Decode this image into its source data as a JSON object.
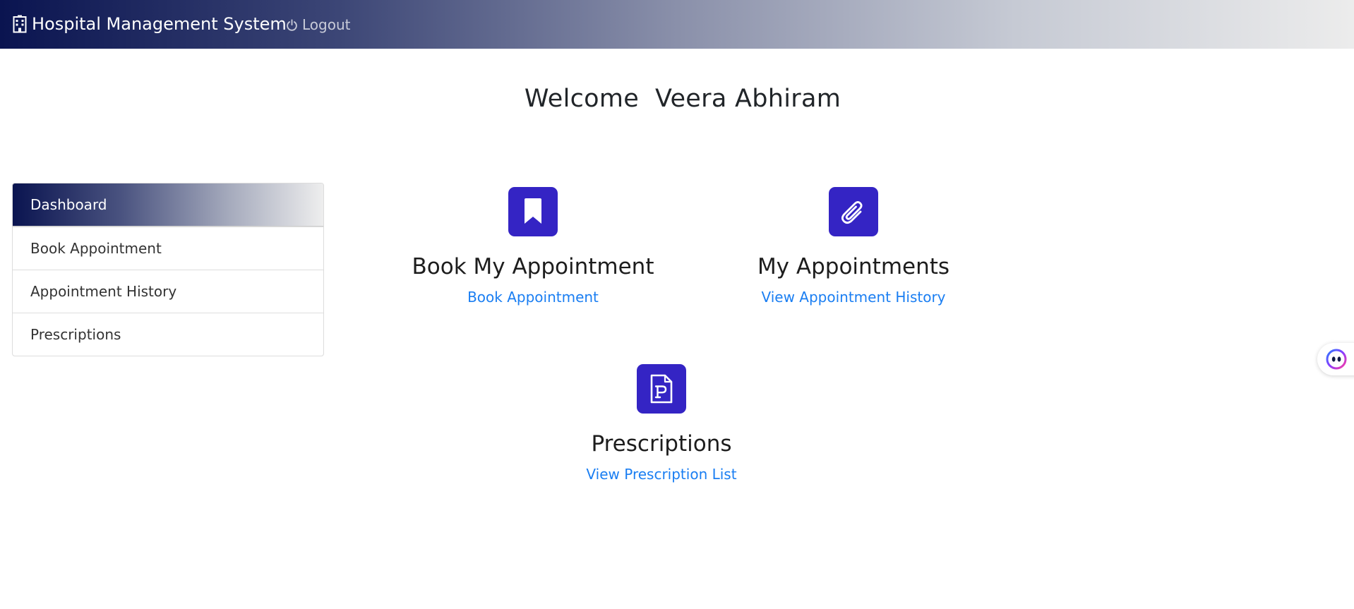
{
  "navbar": {
    "brand_label": "Hospital Management System",
    "brand_icon": "hospital-icon",
    "logout_label": "Logout",
    "logout_icon": "power-icon",
    "gradient_start": "#0a1450",
    "gradient_end": "#ececec"
  },
  "welcome": {
    "text": "Welcome  Veera Abhiram"
  },
  "sidebar": {
    "items": [
      {
        "label": "Dashboard",
        "active": true
      },
      {
        "label": "Book Appointment",
        "active": false
      },
      {
        "label": "Appointment History",
        "active": false
      },
      {
        "label": "Prescriptions",
        "active": false
      }
    ]
  },
  "cards": [
    {
      "icon": "bookmark-icon",
      "title": "Book My Appointment",
      "link_label": "Book Appointment"
    },
    {
      "icon": "paperclip-icon",
      "title": "My Appointments",
      "link_label": "View Appointment History"
    },
    {
      "icon": "prescription-file-icon",
      "title": "Prescriptions",
      "link_label": "View Prescription List"
    }
  ],
  "colors": {
    "icon_box": "#3424c4",
    "link": "#1a7ef2",
    "text": "#212529"
  },
  "assistant": {
    "icon": "assistant-bubble-icon"
  }
}
